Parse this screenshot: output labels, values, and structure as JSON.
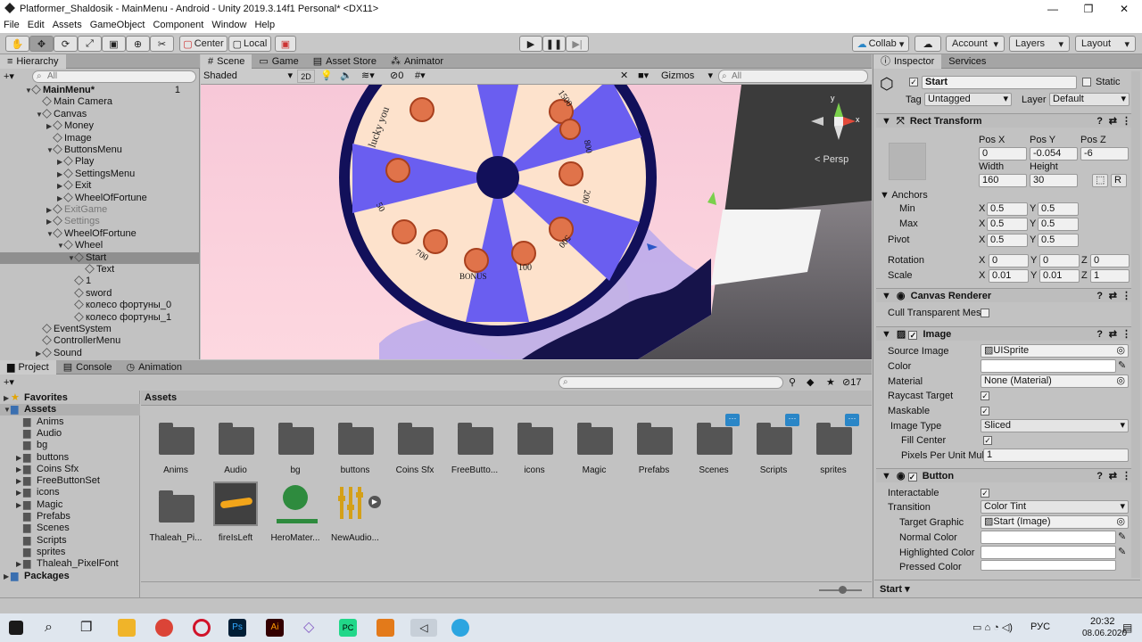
{
  "window": {
    "title": "Platformer_Shaldosik - MainMenu - Android - Unity 2019.3.14f1 Personal* <DX11>",
    "min": "—",
    "max": "❐",
    "close": "✕"
  },
  "menu": [
    "File",
    "Edit",
    "Assets",
    "GameObject",
    "Component",
    "Window",
    "Help"
  ],
  "toolbar": {
    "center": "Center",
    "local": "Local",
    "collab": "Collab",
    "account": "Account",
    "layers": "Layers",
    "layout": "Layout"
  },
  "hierarchy": {
    "title": "Hierarchy",
    "add": "+▾",
    "search": "All",
    "items": [
      {
        "label": "MainMenu*",
        "indent": 0,
        "bold": true,
        "arrow": "▼",
        "badge": "1"
      },
      {
        "label": "Main Camera",
        "indent": 1,
        "arrow": ""
      },
      {
        "label": "Canvas",
        "indent": 1,
        "arrow": "▼"
      },
      {
        "label": "Money",
        "indent": 2,
        "arrow": "▶"
      },
      {
        "label": "Image",
        "indent": 2,
        "arrow": ""
      },
      {
        "label": "ButtonsMenu",
        "indent": 2,
        "arrow": "▼"
      },
      {
        "label": "Play",
        "indent": 3,
        "arrow": "▶"
      },
      {
        "label": "SettingsMenu",
        "indent": 3,
        "arrow": "▶"
      },
      {
        "label": "Exit",
        "indent": 3,
        "arrow": "▶"
      },
      {
        "label": "WheelOfFortune",
        "indent": 3,
        "arrow": "▶"
      },
      {
        "label": "ExitGame",
        "indent": 2,
        "arrow": "▶",
        "grey": true
      },
      {
        "label": "Settings",
        "indent": 2,
        "arrow": "▶",
        "grey": true
      },
      {
        "label": "WheelOfFortune",
        "indent": 2,
        "arrow": "▼"
      },
      {
        "label": "Wheel",
        "indent": 3,
        "arrow": "▼"
      },
      {
        "label": "Start",
        "indent": 4,
        "arrow": "▼",
        "selected": true
      },
      {
        "label": "Text",
        "indent": 5,
        "arrow": ""
      },
      {
        "label": "1",
        "indent": 4,
        "arrow": ""
      },
      {
        "label": "sword",
        "indent": 4,
        "arrow": ""
      },
      {
        "label": "колесо фортуны_0",
        "indent": 4,
        "arrow": ""
      },
      {
        "label": "колесо фортуны_1",
        "indent": 4,
        "arrow": ""
      },
      {
        "label": "EventSystem",
        "indent": 1,
        "arrow": ""
      },
      {
        "label": "ControllerMenu",
        "indent": 1,
        "arrow": ""
      },
      {
        "label": "Sound",
        "indent": 1,
        "arrow": "▶"
      }
    ]
  },
  "scene": {
    "tabs": [
      "Scene",
      "Game",
      "Asset Store",
      "Animator"
    ],
    "shading": "Shaded",
    "mode2d": "2D",
    "hidden": "0",
    "gizmos": "Gizmos",
    "search": "All",
    "persp": "< Persp",
    "axis": {
      "y": "y",
      "x": "x"
    },
    "wheel": {
      "labels": [
        "lucky you",
        "1500",
        "800",
        "200",
        "500",
        "100",
        "BONUS",
        "700",
        "50"
      ],
      "colors": {
        "blue": "#6a5ef0",
        "peach": "#fde2cc",
        "navy": "#12105a"
      }
    }
  },
  "project": {
    "tabs": [
      "Project",
      "Console",
      "Animation"
    ],
    "add": "+▾",
    "count": "17",
    "tree": [
      {
        "label": "Favorites",
        "indent": 0,
        "arrow": "▶",
        "bold": true,
        "icon": "star-icon"
      },
      {
        "label": "Assets",
        "indent": 0,
        "arrow": "▼",
        "bold": true
      },
      {
        "label": "Anims",
        "indent": 1,
        "arrow": ""
      },
      {
        "label": "Audio",
        "indent": 1,
        "arrow": ""
      },
      {
        "label": "bg",
        "indent": 1,
        "arrow": ""
      },
      {
        "label": "buttons",
        "indent": 1,
        "arrow": "▶"
      },
      {
        "label": "Coins Sfx",
        "indent": 1,
        "arrow": "▶"
      },
      {
        "label": "FreeButtonSet",
        "indent": 1,
        "arrow": "▶"
      },
      {
        "label": "icons",
        "indent": 1,
        "arrow": "▶"
      },
      {
        "label": "Magic",
        "indent": 1,
        "arrow": "▶"
      },
      {
        "label": "Prefabs",
        "indent": 1,
        "arrow": ""
      },
      {
        "label": "Scenes",
        "indent": 1,
        "arrow": ""
      },
      {
        "label": "Scripts",
        "indent": 1,
        "arrow": ""
      },
      {
        "label": "sprites",
        "indent": 1,
        "arrow": ""
      },
      {
        "label": "Thaleah_PixelFont",
        "indent": 1,
        "arrow": "▶"
      },
      {
        "label": "Packages",
        "indent": 0,
        "arrow": "▶",
        "bold": true
      }
    ],
    "breadcrumb": "Assets",
    "assets": [
      {
        "label": "Anims",
        "kind": "folder"
      },
      {
        "label": "Audio",
        "kind": "folder"
      },
      {
        "label": "bg",
        "kind": "folder"
      },
      {
        "label": "buttons",
        "kind": "folder"
      },
      {
        "label": "Coins Sfx",
        "kind": "folder"
      },
      {
        "label": "FreeButto...",
        "kind": "folder"
      },
      {
        "label": "icons",
        "kind": "folder"
      },
      {
        "label": "Magic",
        "kind": "folder"
      },
      {
        "label": "Prefabs",
        "kind": "folder"
      },
      {
        "label": "Scenes",
        "kind": "folder",
        "dots": true
      },
      {
        "label": "Scripts",
        "kind": "folder",
        "dots": true
      },
      {
        "label": "sprites",
        "kind": "folder",
        "dots": true
      },
      {
        "label": "Thaleah_Pi...",
        "kind": "folder"
      },
      {
        "label": "fireIsLeft",
        "kind": "fire"
      },
      {
        "label": "HeroMater...",
        "kind": "material"
      },
      {
        "label": "NewAudio...",
        "kind": "mixer"
      }
    ]
  },
  "inspector": {
    "tabs": [
      "Inspector",
      "Services"
    ],
    "name": "Start",
    "static": "Static",
    "tag_label": "Tag",
    "tag": "Untagged",
    "layer_label": "Layer",
    "layer": "Default",
    "rect": {
      "title": "Rect Transform",
      "posx_label": "Pos X",
      "posy_label": "Pos Y",
      "posz_label": "Pos Z",
      "posx": "0",
      "posy": "-0.054",
      "posz": "-6",
      "width_label": "Width",
      "height_label": "Height",
      "width": "160",
      "height": "30",
      "r": "R",
      "anchors": "Anchors",
      "min": "Min",
      "max": "Max",
      "pivot": "Pivot",
      "min_x": "0.5",
      "min_y": "0.5",
      "max_x": "0.5",
      "max_y": "0.5",
      "pivot_x": "0.5",
      "pivot_y": "0.5",
      "rotation": "Rotation",
      "scale": "Scale",
      "rot_x": "0",
      "rot_y": "0",
      "rot_z": "0",
      "scale_x": "0.01",
      "scale_y": "0.01",
      "scale_z": "1"
    },
    "canvas_renderer": {
      "title": "Canvas Renderer",
      "cull": "Cull Transparent Mes"
    },
    "image": {
      "title": "Image",
      "source_label": "Source Image",
      "source": "UISprite",
      "color_label": "Color",
      "material_label": "Material",
      "material": "None (Material)",
      "raycast": "Raycast Target",
      "maskable": "Maskable",
      "type_label": "Image Type",
      "type": "Sliced",
      "fill": "Fill Center",
      "ppu_label": "Pixels Per Unit Mul",
      "ppu": "1"
    },
    "button": {
      "title": "Button",
      "interactable": "Interactable",
      "transition_label": "Transition",
      "transition": "Color Tint",
      "target_label": "Target Graphic",
      "target": "Start (Image)",
      "normal": "Normal Color",
      "highlighted": "Highlighted Color",
      "pressed": "Pressed Color"
    },
    "footer": "Start"
  },
  "taskbar": {
    "lang": "РУС",
    "time": "20:32",
    "date": "08.06.2020"
  }
}
